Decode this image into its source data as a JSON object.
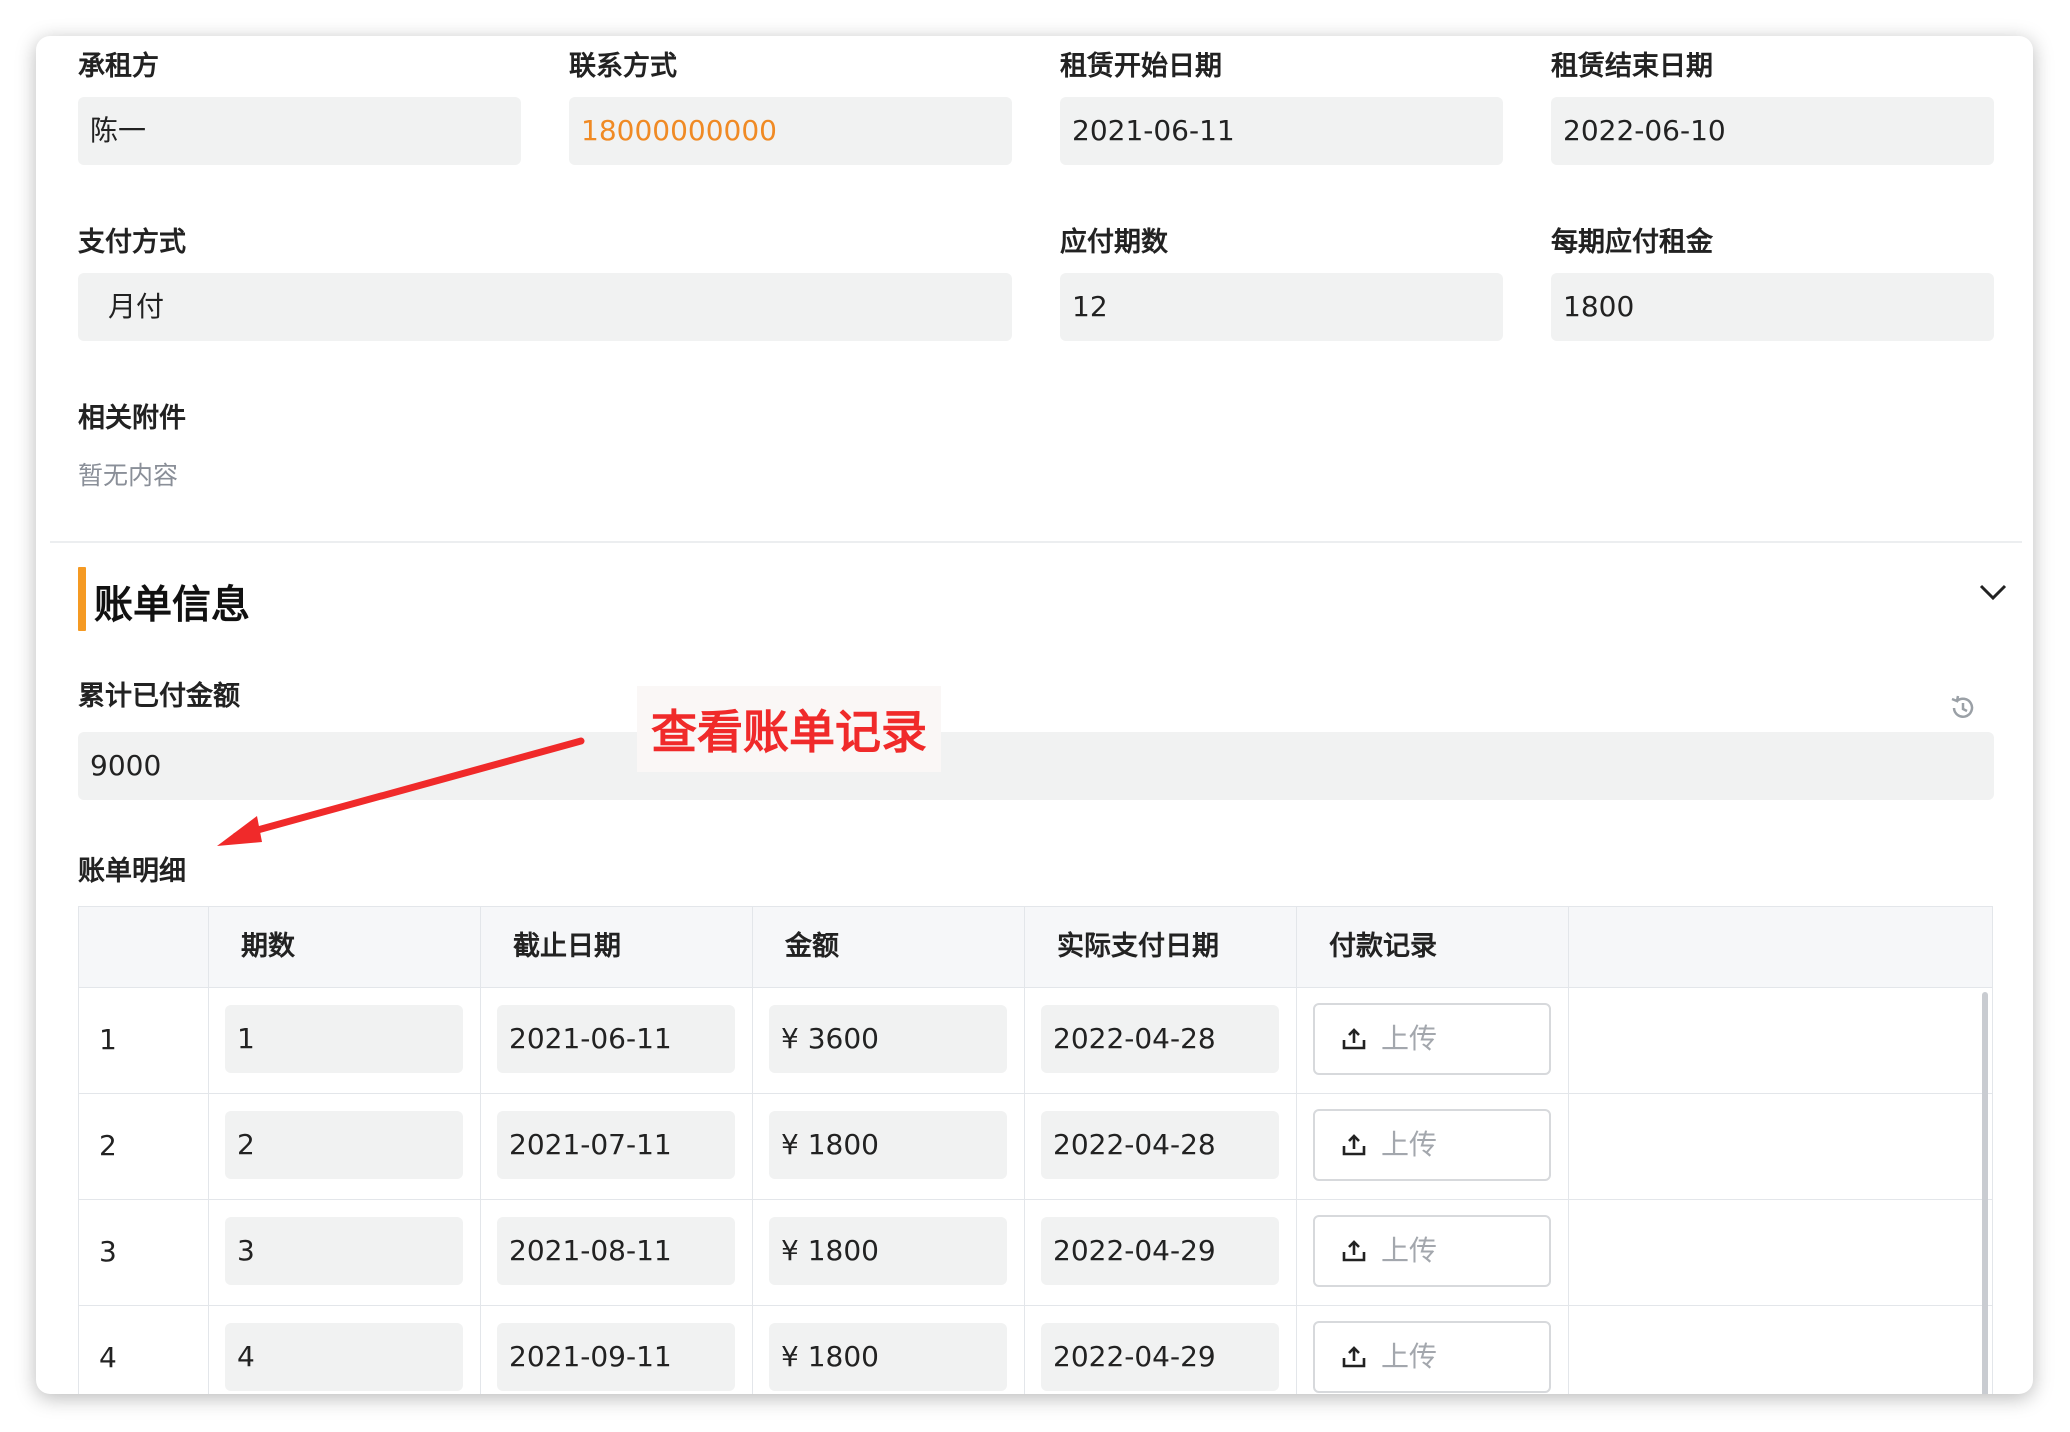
{
  "form": {
    "tenant_label": "承租方",
    "tenant_value": "陈一",
    "contact_label": "联系方式",
    "contact_value": "18000000000",
    "start_label": "租赁开始日期",
    "start_value": "2021-06-11",
    "end_label": "租赁结束日期",
    "end_value": "2022-06-10",
    "payment_label": "支付方式",
    "payment_value": "月付",
    "periods_label": "应付期数",
    "periods_value": "12",
    "rent_label": "每期应付租金",
    "rent_value": "1800",
    "attachments_label": "相关附件",
    "attachments_value": "暂无内容"
  },
  "billing": {
    "section_title": "账单信息",
    "total_paid_label": "累计已付金额",
    "total_paid_value": "9000",
    "detail_label": "账单明细"
  },
  "annotation": {
    "text": "查看账单记录",
    "color": "#f02a2a"
  },
  "table": {
    "headers": [
      "期数",
      "截止日期",
      "金额",
      "实际支付日期",
      "付款记录"
    ],
    "upload_label": "上传",
    "rows": [
      {
        "index": "1",
        "period": "1",
        "due": "2021-06-11",
        "amount": "¥ 3600",
        "paid": "2022-04-28"
      },
      {
        "index": "2",
        "period": "2",
        "due": "2021-07-11",
        "amount": "¥ 1800",
        "paid": "2022-04-28"
      },
      {
        "index": "3",
        "period": "3",
        "due": "2021-08-11",
        "amount": "¥ 1800",
        "paid": "2022-04-29"
      },
      {
        "index": "4",
        "period": "4",
        "due": "2021-09-11",
        "amount": "¥ 1800",
        "paid": "2022-04-29"
      }
    ]
  },
  "icons": {
    "collapse": "chevron-down-icon",
    "history": "history-icon",
    "upload": "upload-icon"
  },
  "colors": {
    "accent": "#f59a23",
    "contact_text": "#f08a24"
  }
}
